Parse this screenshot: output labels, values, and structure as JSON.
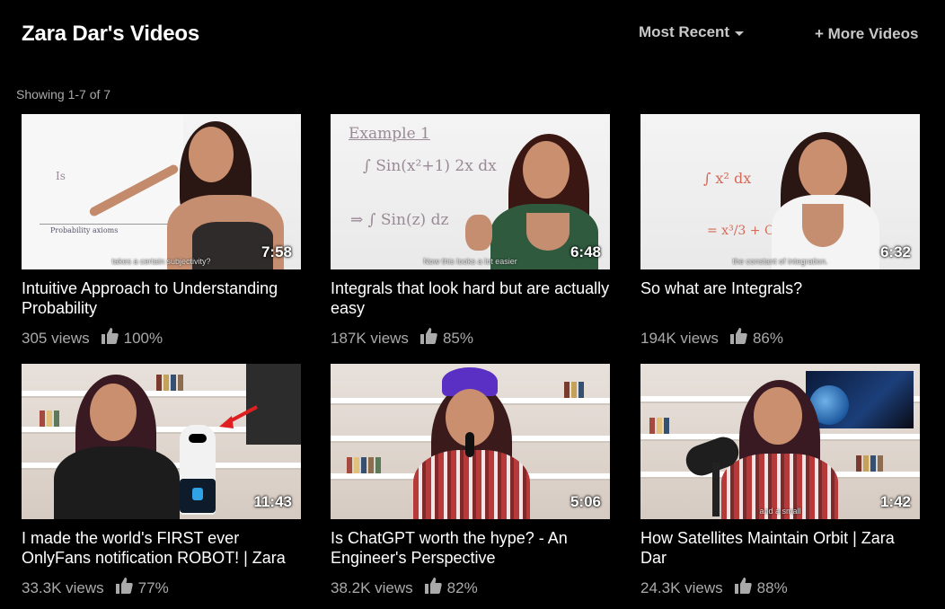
{
  "header": {
    "title": "Zara Dar's Videos",
    "sort_label": "Most Recent",
    "more_label": "+ More Videos",
    "showing": "Showing 1-7 of 7"
  },
  "videos": [
    {
      "title": "Intuitive Approach to Understanding Probability",
      "views": "305 views",
      "rating": "100%",
      "duration": "7:58",
      "caption": "takes a certain subjectivity?"
    },
    {
      "title": "Integrals that look hard but are actually easy",
      "views": "187K views",
      "rating": "85%",
      "duration": "6:48",
      "caption": "Now this looks a lot easier"
    },
    {
      "title": "So what are Integrals?",
      "views": "194K views",
      "rating": "86%",
      "duration": "6:32",
      "caption": "the constant of integration."
    },
    {
      "title": "I made the world's FIRST ever OnlyFans notification ROBOT! | Zara",
      "views": "33.3K views",
      "rating": "77%",
      "duration": "11:43",
      "caption": ""
    },
    {
      "title": "Is ChatGPT worth the hype? - An Engineer's Perspective",
      "views": "38.2K views",
      "rating": "82%",
      "duration": "5:06",
      "caption": ""
    },
    {
      "title": "How Satellites Maintain Orbit | Zara Dar",
      "views": "24.3K views",
      "rating": "88%",
      "duration": "1:42",
      "caption": "and a small"
    }
  ],
  "thumb_text": {
    "v1_board": "Is",
    "v1_notes": "Probability axioms",
    "v2_heading": "Example 1",
    "v2_integral": "∫ Sin(x²+1) 2x dx",
    "v2_result": "⇒ ∫ Sin(z) dz",
    "v3_integral": "∫ x² dx",
    "v3_result": "= x³/3 + C"
  },
  "colors": {
    "background": "#000000",
    "text_primary": "#ffffff",
    "text_secondary": "#aaaaaa",
    "header_controls": "#c8c8c8"
  }
}
